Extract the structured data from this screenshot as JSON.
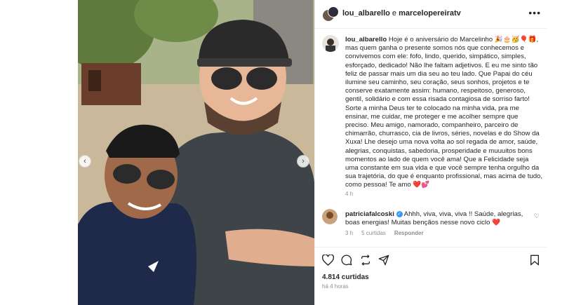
{
  "post": {
    "header": {
      "user1": "lou_albarello",
      "joiner": "e",
      "user2": "marcelopereiratv"
    },
    "caption": {
      "username": "lou_albarello",
      "text": "Hoje é o aniversário do Marcelinho 🎉🎂🥳🎈🎁, mas quem ganha o presente somos nós que conhecemos e convivemos com ele: fofo, lindo, querido, simpático, simples, esforçado, dedicado! Não lhe faltam adjetivos. E eu me sinto tão feliz de passar mais um dia seu ao teu lado. Que Papai do céu ilumine seu caminho, seu coração, seus sonhos, projetos e te conserve exatamente assim: humano, respeitoso, generoso, gentil, solidário e com essa risada contagiosa de sorriso farto! Sorte a minha Deus ter te colocado na minha vida, pra me ensinar, me cuidar, me proteger e me acolher sempre que preciso. Meu amigo, namorado, companheiro, parceiro de chimarrão, churrasco, cia de livros, séries, novelas e do Show da Xuxa! Lhe desejo uma nova volta ao sol regada de amor, saúde, alegrias, conquistas, sabedoria, prosperidade e muuuitos bons momentos ao lado de quem você ama! Que a Felicidade seja uma constante em sua vida e que você sempre tenha orgulho da sua trajetória, do que é enquanto profissional, mas acima de tudo, como pessoa! Te amo ❤️💕",
      "time": "4 h"
    },
    "comment": {
      "username": "patriciafalcoski",
      "verified_mark": "✓",
      "text": "Ahhh, viva, viva, viva !! Saúde, alegrias, boas energias! Muitas bençãos nesse novo ciclo ❤️",
      "time": "3 h",
      "likes": "5 curtidas",
      "reply": "Responder"
    },
    "likes_count": "4.814 curtidas",
    "posted_ago": "há 4 horas"
  },
  "icons": {
    "more": "more-horizontal-icon",
    "like": "heart-icon",
    "comment": "comment-icon",
    "share": "share-icon",
    "save": "bookmark-icon",
    "prev": "chevron-left-icon",
    "next": "chevron-right-icon"
  }
}
